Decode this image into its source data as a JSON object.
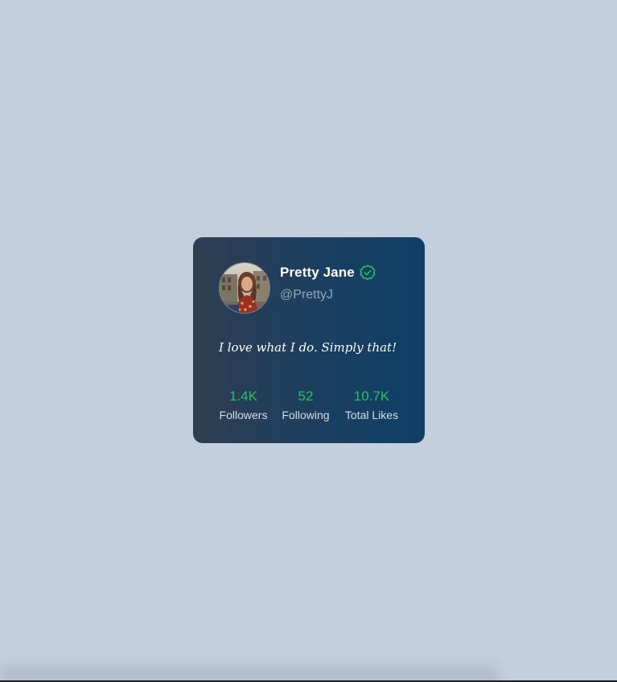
{
  "profile": {
    "name": "Pretty Jane",
    "handle": "@PrettyJ",
    "bio": "I love what I do. Simply that!",
    "verified_icon": "verified-badge-icon",
    "avatar": "profile-photo"
  },
  "stats": [
    {
      "value": "1.4K",
      "label": "Followers"
    },
    {
      "value": "52",
      "label": "Following"
    },
    {
      "value": "10.7K",
      "label": "Total Likes"
    }
  ],
  "colors": {
    "page_background": "#c4cfde",
    "card_gradient_start": "#2f3e52",
    "card_gradient_end": "#0f3f66",
    "accent_green": "#22c55e",
    "handle_gray": "#9aa7b8"
  }
}
